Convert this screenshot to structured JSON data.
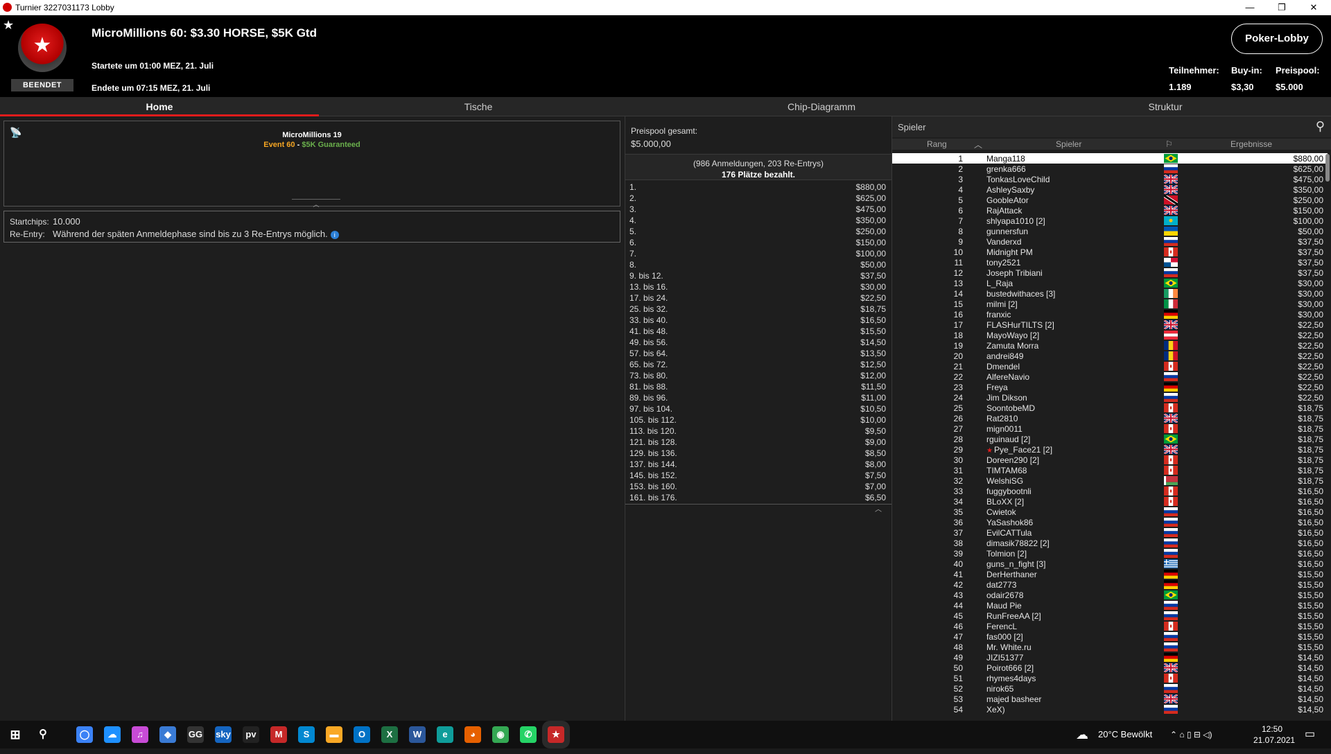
{
  "window": {
    "title": "Turnier 3227031173 Lobby",
    "min_icon": "minimize-icon",
    "max_icon": "maximize-icon",
    "close_icon": "close-icon",
    "min_glyph": "—",
    "max_glyph": "❐",
    "close_glyph": "✕"
  },
  "header": {
    "star": "★",
    "logo_star": "★",
    "status_badge": "BEENDET",
    "title": "MicroMillions 60: $3.30 HORSE, $5K Gtd",
    "started": "Startete um 01:00 MEZ, 21. Juli",
    "ended": "Endete um 07:15 MEZ, 21. Juli",
    "lobby_button": "Poker-Lobby",
    "stats": [
      {
        "label": "Teilnehmer:",
        "value": "1.189"
      },
      {
        "label": "Buy-in:",
        "value": "$3,30"
      },
      {
        "label": "Preispool:",
        "value": "$5.000"
      }
    ]
  },
  "tabs": [
    "Home",
    "Tische",
    "Chip-Diagramm",
    "Struktur"
  ],
  "info": {
    "antenna": "📡",
    "series": "MicroMillions 19",
    "event": "Event 60",
    "separator": " - ",
    "guaranteed": "$5K Guaranteed",
    "collapse_glyph": "︿",
    "startchips_label": "Startchips:",
    "startchips_value": "10.000",
    "reentry_label": "Re-Entry:",
    "reentry_value": "Während der späten Anmeldephase sind bis zu 3 Re-Entrys möglich.",
    "info_glyph": "i"
  },
  "prizepool": {
    "title": "Preispool gesamt:",
    "total": "$5.000,00",
    "registrations": "(986 Anmeldungen, 203 Re-Entrys)",
    "paid": "176 Plätze bezahlt.",
    "collapse_glyph": "︿",
    "payouts": [
      {
        "place": "1.",
        "amount": "$880,00"
      },
      {
        "place": "2.",
        "amount": "$625,00"
      },
      {
        "place": "3.",
        "amount": "$475,00"
      },
      {
        "place": "4.",
        "amount": "$350,00"
      },
      {
        "place": "5.",
        "amount": "$250,00"
      },
      {
        "place": "6.",
        "amount": "$150,00"
      },
      {
        "place": "7.",
        "amount": "$100,00"
      },
      {
        "place": "8.",
        "amount": "$50,00"
      },
      {
        "place": "9. bis 12.",
        "amount": "$37,50"
      },
      {
        "place": "13. bis 16.",
        "amount": "$30,00"
      },
      {
        "place": "17. bis 24.",
        "amount": "$22,50"
      },
      {
        "place": "25. bis 32.",
        "amount": "$18,75"
      },
      {
        "place": "33. bis 40.",
        "amount": "$16,50"
      },
      {
        "place": "41. bis 48.",
        "amount": "$15,50"
      },
      {
        "place": "49. bis 56.",
        "amount": "$14,50"
      },
      {
        "place": "57. bis 64.",
        "amount": "$13,50"
      },
      {
        "place": "65. bis 72.",
        "amount": "$12,50"
      },
      {
        "place": "73. bis 80.",
        "amount": "$12,00"
      },
      {
        "place": "81. bis 88.",
        "amount": "$11,50"
      },
      {
        "place": "89. bis 96.",
        "amount": "$11,00"
      },
      {
        "place": "97. bis 104.",
        "amount": "$10,50"
      },
      {
        "place": "105. bis 112.",
        "amount": "$10,00"
      },
      {
        "place": "113. bis 120.",
        "amount": "$9,50"
      },
      {
        "place": "121. bis 128.",
        "amount": "$9,00"
      },
      {
        "place": "129. bis 136.",
        "amount": "$8,50"
      },
      {
        "place": "137. bis 144.",
        "amount": "$8,00"
      },
      {
        "place": "145. bis 152.",
        "amount": "$7,50"
      },
      {
        "place": "153. bis 160.",
        "amount": "$7,00"
      },
      {
        "place": "161. bis 176.",
        "amount": "$6,50"
      }
    ]
  },
  "players": {
    "search_placeholder": "Spieler",
    "search_icon": "search-icon",
    "search_glyph": "⚲",
    "columns": {
      "rank": "Rang",
      "sort_glyph": "︿",
      "player": "Spieler",
      "flag_glyph": "⚐",
      "result": "Ergebnisse"
    },
    "rows": [
      {
        "rank": "1",
        "name": "Manga118",
        "flag": "br",
        "result": "$880,00"
      },
      {
        "rank": "2",
        "name": "grenka666",
        "flag": "ru",
        "result": "$625,00"
      },
      {
        "rank": "3",
        "name": "TonkasLoveChild",
        "flag": "gb",
        "result": "$475,00"
      },
      {
        "rank": "4",
        "name": "AshleySaxby",
        "flag": "gb",
        "result": "$350,00"
      },
      {
        "rank": "5",
        "name": "GoobleAtor",
        "flag": "tt",
        "result": "$250,00"
      },
      {
        "rank": "6",
        "name": "RajAttack",
        "flag": "gb",
        "result": "$150,00"
      },
      {
        "rank": "7",
        "name": "shlyapa1010 [2]",
        "flag": "kz",
        "result": "$100,00"
      },
      {
        "rank": "8",
        "name": "gunnersfun",
        "flag": "ua",
        "result": "$50,00"
      },
      {
        "rank": "9",
        "name": "Vanderxd",
        "flag": "ru",
        "result": "$37,50"
      },
      {
        "rank": "10",
        "name": "Midnight PM",
        "flag": "ca",
        "result": "$37,50"
      },
      {
        "rank": "11",
        "name": "tony2521",
        "flag": "pa",
        "result": "$37,50"
      },
      {
        "rank": "12",
        "name": "Joseph Tribiani",
        "flag": "ru",
        "result": "$37,50"
      },
      {
        "rank": "13",
        "name": "L_Raja",
        "flag": "br",
        "result": "$30,00"
      },
      {
        "rank": "14",
        "name": "bustedwithaces [3]",
        "flag": "ie",
        "result": "$30,00"
      },
      {
        "rank": "15",
        "name": "milmi [2]",
        "flag": "it",
        "result": "$30,00"
      },
      {
        "rank": "16",
        "name": "franxic",
        "flag": "de",
        "result": "$30,00"
      },
      {
        "rank": "17",
        "name": "FLASHurTILTS [2]",
        "flag": "gb",
        "result": "$22,50"
      },
      {
        "rank": "18",
        "name": "MayoWayo [2]",
        "flag": "at",
        "result": "$22,50"
      },
      {
        "rank": "19",
        "name": "Zamuta Morra",
        "flag": "ro",
        "result": "$22,50"
      },
      {
        "rank": "20",
        "name": "andrei849",
        "flag": "ro",
        "result": "$22,50"
      },
      {
        "rank": "21",
        "name": "Dmendel",
        "flag": "ca",
        "result": "$22,50"
      },
      {
        "rank": "22",
        "name": "AlfereNavio",
        "flag": "ru",
        "result": "$22,50"
      },
      {
        "rank": "23",
        "name": "Freya",
        "flag": "de",
        "result": "$22,50"
      },
      {
        "rank": "24",
        "name": "Jim Dikson",
        "flag": "ru",
        "result": "$22,50"
      },
      {
        "rank": "25",
        "name": "SoontobeMD",
        "flag": "ca",
        "result": "$18,75"
      },
      {
        "rank": "26",
        "name": "Rat2810",
        "flag": "gb",
        "result": "$18,75"
      },
      {
        "rank": "27",
        "name": "mign0011",
        "flag": "ca",
        "result": "$18,75"
      },
      {
        "rank": "28",
        "name": "rguinaud [2]",
        "flag": "br",
        "result": "$18,75"
      },
      {
        "rank": "29",
        "name": "Pye_Face21 [2]",
        "flag": "gb",
        "result": "$18,75",
        "star": "★"
      },
      {
        "rank": "30",
        "name": "Doreen290 [2]",
        "flag": "ca",
        "result": "$18,75"
      },
      {
        "rank": "31",
        "name": "TIMTAM68",
        "flag": "ca",
        "result": "$18,75"
      },
      {
        "rank": "32",
        "name": "WelshiSG",
        "flag": "by",
        "result": "$18,75"
      },
      {
        "rank": "33",
        "name": "fuggybootnli",
        "flag": "ca",
        "result": "$16,50"
      },
      {
        "rank": "34",
        "name": "BLoXX [2]",
        "flag": "ca",
        "result": "$16,50"
      },
      {
        "rank": "35",
        "name": "Cwietok",
        "flag": "ru",
        "result": "$16,50"
      },
      {
        "rank": "36",
        "name": "YaSashok86",
        "flag": "ru",
        "result": "$16,50"
      },
      {
        "rank": "37",
        "name": "EvilCATTula",
        "flag": "ru",
        "result": "$16,50"
      },
      {
        "rank": "38",
        "name": "dimasik78822 [2]",
        "flag": "ru",
        "result": "$16,50"
      },
      {
        "rank": "39",
        "name": "Tolmion [2]",
        "flag": "ru",
        "result": "$16,50"
      },
      {
        "rank": "40",
        "name": "guns_n_fight [3]",
        "flag": "gr",
        "result": "$16,50"
      },
      {
        "rank": "41",
        "name": "DerHerthaner",
        "flag": "de",
        "result": "$15,50"
      },
      {
        "rank": "42",
        "name": "dat2773",
        "flag": "de",
        "result": "$15,50"
      },
      {
        "rank": "43",
        "name": "odair2678",
        "flag": "br",
        "result": "$15,50"
      },
      {
        "rank": "44",
        "name": "Maud Pie",
        "flag": "ru",
        "result": "$15,50"
      },
      {
        "rank": "45",
        "name": "RunFreeAA [2]",
        "flag": "ru",
        "result": "$15,50"
      },
      {
        "rank": "46",
        "name": "FerencL",
        "flag": "ca",
        "result": "$15,50"
      },
      {
        "rank": "47",
        "name": "fas000 [2]",
        "flag": "ru",
        "result": "$15,50"
      },
      {
        "rank": "48",
        "name": "Mr. White.ru",
        "flag": "ru",
        "result": "$15,50"
      },
      {
        "rank": "49",
        "name": "JIZI51377",
        "flag": "de",
        "result": "$14,50"
      },
      {
        "rank": "50",
        "name": "Poirot666 [2]",
        "flag": "gb",
        "result": "$14,50"
      },
      {
        "rank": "51",
        "name": "rhymes4days",
        "flag": "ca",
        "result": "$14,50"
      },
      {
        "rank": "52",
        "name": "nirok65",
        "flag": "ru",
        "result": "$14,50"
      },
      {
        "rank": "53",
        "name": "majed basheer",
        "flag": "gb",
        "result": "$14,50"
      },
      {
        "rank": "54",
        "name": "XeX)",
        "flag": "ru",
        "result": "$14,50"
      }
    ]
  },
  "taskbar": {
    "start_glyph": "⊞",
    "search_glyph": "⚲",
    "apps": [
      {
        "name": "cortana-icon",
        "glyph": "◯",
        "color": "#3b82f6"
      },
      {
        "name": "onedrive-icon",
        "glyph": "☁",
        "color": "#1e90ff"
      },
      {
        "name": "itunes-icon",
        "glyph": "♫",
        "color": "#c84bd6"
      },
      {
        "name": "app-icon",
        "glyph": "◆",
        "color": "#3a7bd5"
      },
      {
        "name": "gg-icon",
        "glyph": "GG",
        "color": "#333333"
      },
      {
        "name": "sky-icon",
        "glyph": "sky",
        "color": "#1565c0"
      },
      {
        "name": "prime-video-icon",
        "glyph": "pv",
        "color": "#222222"
      },
      {
        "name": "mcafee-icon",
        "glyph": "M",
        "color": "#c62828"
      },
      {
        "name": "skype-icon",
        "glyph": "S",
        "color": "#0288d1"
      },
      {
        "name": "explorer-icon",
        "glyph": "▬",
        "color": "#f9a825"
      },
      {
        "name": "outlook-icon",
        "glyph": "O",
        "color": "#0072c6"
      },
      {
        "name": "excel-icon",
        "glyph": "X",
        "color": "#1d6f42"
      },
      {
        "name": "word-icon",
        "glyph": "W",
        "color": "#2b579a"
      },
      {
        "name": "edge-icon",
        "glyph": "e",
        "color": "#0f9d9a"
      },
      {
        "name": "firefox-icon",
        "glyph": "◕",
        "color": "#e66000"
      },
      {
        "name": "chrome-icon",
        "glyph": "◉",
        "color": "#34a853"
      },
      {
        "name": "whatsapp-icon",
        "glyph": "✆",
        "color": "#25d366"
      },
      {
        "name": "pokerstars-icon",
        "glyph": "★",
        "color": "#c62828"
      }
    ],
    "weather_glyph": "☁",
    "weather": "20°C  Bewölkt",
    "tray_glyphs": "⌃  ⌂  ▯  ⊟  ◁)",
    "time": "12:50",
    "date": "21.07.2021",
    "notify_glyph": "▭"
  }
}
